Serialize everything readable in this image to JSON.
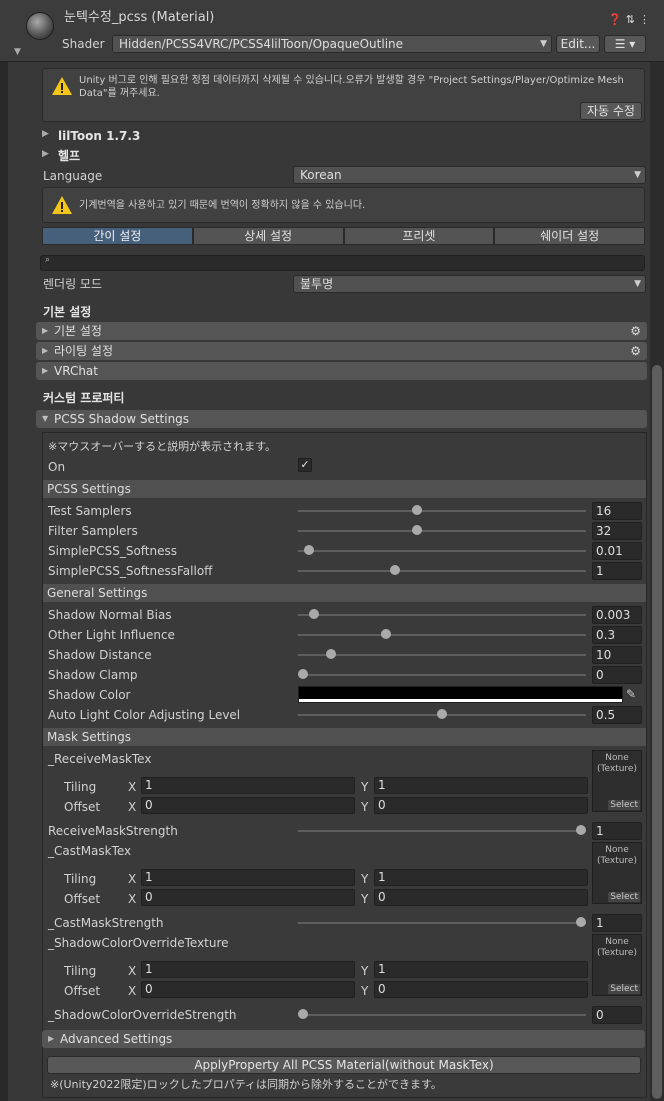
{
  "header": {
    "title": "눈텍수정_pcss (Material)",
    "shader_label": "Shader",
    "shader_value": "Hidden/PCSS4VRC/PCSS4lilToon/OpaqueOutline",
    "edit_label": "Edit...",
    "icons": [
      "help-icon",
      "presets-icon",
      "kebab-menu-icon"
    ]
  },
  "warning_box": {
    "text": "Unity 버그로 인해 필요한 정점 데이터까지 삭제될 수 있습니다.오류가 발생할 경우 \"Project Settings/Player/Optimize Mesh Data\"를 꺼주세요.",
    "button_label": "자동 수정"
  },
  "liltoon_version": "lilToon 1.7.3",
  "help_label": "헬프",
  "language": {
    "label": "Language",
    "value": "Korean"
  },
  "translation_notice": "기계번역을 사용하고 있기 때문에 번역이 정확하지 않을 수 있습니다.",
  "tabs": [
    {
      "label": "간이 설정",
      "active": true
    },
    {
      "label": "상세 설정",
      "active": false
    },
    {
      "label": "프리셋",
      "active": false
    },
    {
      "label": "쉐이더 설정",
      "active": false
    }
  ],
  "search": {
    "placeholder": ""
  },
  "rendering_mode": {
    "label": "렌더링 모드",
    "value": "불투명"
  },
  "basic_settings": {
    "title": "기본 설정",
    "foldouts": [
      {
        "label": "기본 설정",
        "has_gear": true
      },
      {
        "label": "라이팅 설정",
        "has_gear": true
      },
      {
        "label": "VRChat",
        "has_gear": false
      }
    ]
  },
  "custom_props": {
    "title": "커스텀 프로퍼티",
    "pcss_foldout": "PCSS Shadow Settings"
  },
  "pcss": {
    "hint": "※マウスオーバーすると説明が表示されます。",
    "on_label": "On",
    "on_checked": true,
    "pcss_settings_title": "PCSS Settings",
    "pcss_settings": [
      {
        "label": "Test Samplers",
        "value": "16",
        "fraction": 0.41
      },
      {
        "label": "Filter Samplers",
        "value": "32",
        "fraction": 0.41
      },
      {
        "label": "SimplePCSS_Softness",
        "value": "0.01",
        "fraction": 0.02
      },
      {
        "label": "SimplePCSS_SoftnessFalloff",
        "value": "1",
        "fraction": 0.33
      }
    ],
    "general_settings_title": "General Settings",
    "general_settings": [
      {
        "label": "Shadow Normal Bias",
        "value": "0.003",
        "fraction": 0.04
      },
      {
        "label": "Other Light Influence",
        "value": "0.3",
        "fraction": 0.3
      },
      {
        "label": "Shadow Distance",
        "value": "10",
        "fraction": 0.1
      },
      {
        "label": "Shadow Clamp",
        "value": "0",
        "fraction": 0.0
      },
      {
        "label": "Shadow Color",
        "color": "#000000"
      },
      {
        "label": "Auto Light Color Adjusting Level",
        "value": "0.5",
        "fraction": 0.5
      }
    ],
    "mask_settings_title": "Mask Settings",
    "textures": [
      {
        "name": "_ReceiveMaskTex",
        "tiling_x": "1",
        "tiling_y": "1",
        "offset_x": "0",
        "offset_y": "0",
        "strength_label": "ReceiveMaskStrength",
        "strength_value": "1",
        "strength_fraction": 1.0
      },
      {
        "name": "_CastMaskTex",
        "tiling_x": "1",
        "tiling_y": "1",
        "offset_x": "0",
        "offset_y": "0",
        "strength_label": "_CastMaskStrength",
        "strength_value": "1",
        "strength_fraction": 1.0
      },
      {
        "name": "_ShadowColorOverrideTexture",
        "tiling_x": "1",
        "tiling_y": "1",
        "offset_x": "0",
        "offset_y": "0",
        "strength_label": "_ShadowColorOverrideStrength",
        "strength_value": "0",
        "strength_fraction": 0.0
      }
    ],
    "tiling_label": "Tiling",
    "offset_label": "Offset",
    "x_label": "X",
    "y_label": "Y",
    "tex_none": "None",
    "tex_type": "(Texture)",
    "tex_select": "Select",
    "advanced_label": "Advanced Settings",
    "apply_label": "ApplyProperty All PCSS Material(without MaskTex)",
    "footer_note": "※(Unity2022限定)ロックしたプロパティは同期から除外することができます。"
  }
}
